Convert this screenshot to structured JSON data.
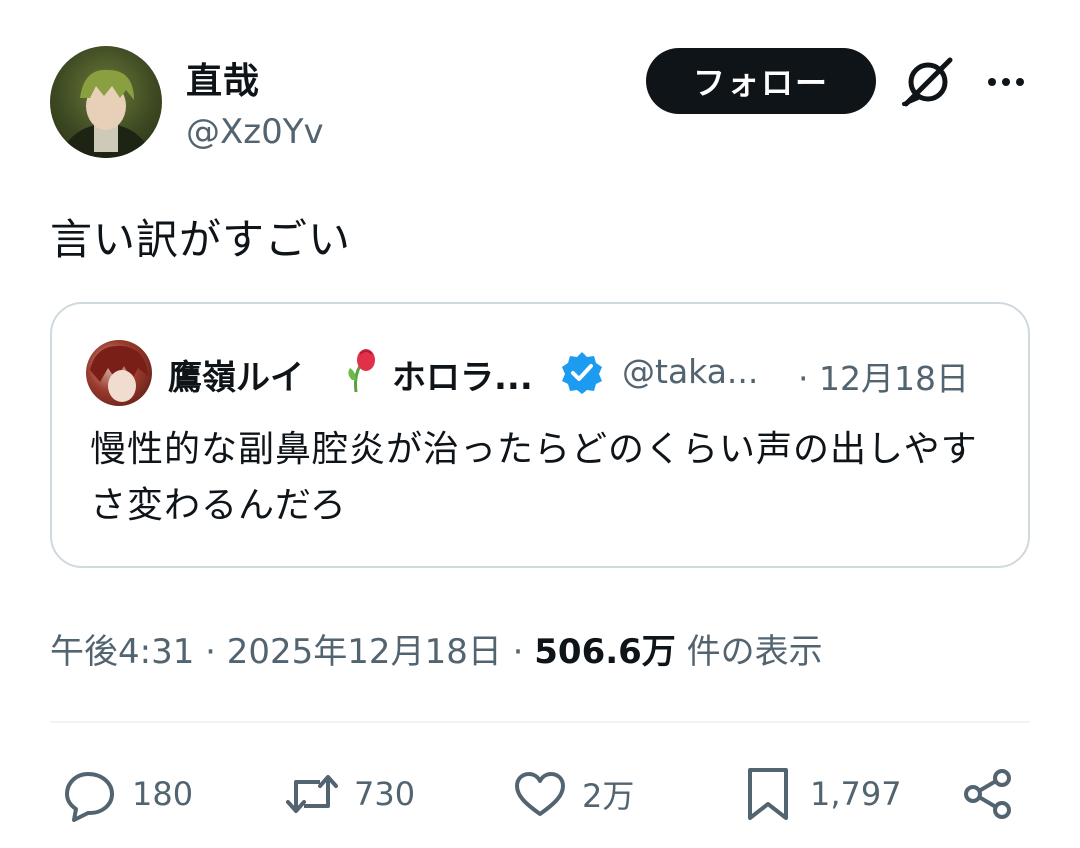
{
  "author": {
    "display_name": "直哉",
    "handle": "@Xz0Yv"
  },
  "header": {
    "follow_label": "フォロー"
  },
  "tweet": {
    "text": "言い訳がすごい"
  },
  "quote": {
    "name": "鷹嶺ルイ",
    "name_suffix": "ホロラ...",
    "handle": "@taka...",
    "date": "· 12月18日",
    "text": "慢性的な副鼻腔炎が治ったらどのくらい声の出しやすさ変わるんだろ"
  },
  "meta": {
    "time": "午後4:31 · 2025年12月18日 · ",
    "views_count": "506.6万",
    "views_label": " 件の表示"
  },
  "actions": {
    "replies": "180",
    "retweets": "730",
    "likes": "2万",
    "bookmarks": "1,797"
  },
  "colors": {
    "text_primary": "#0f1419",
    "text_secondary": "#536471",
    "border": "#cfd9de",
    "verified": "#1d9bf0"
  },
  "icons": [
    "grok-icon",
    "more-icon",
    "verified-icon",
    "rose-icon",
    "reply-icon",
    "retweet-icon",
    "like-icon",
    "bookmark-icon",
    "share-icon"
  ]
}
